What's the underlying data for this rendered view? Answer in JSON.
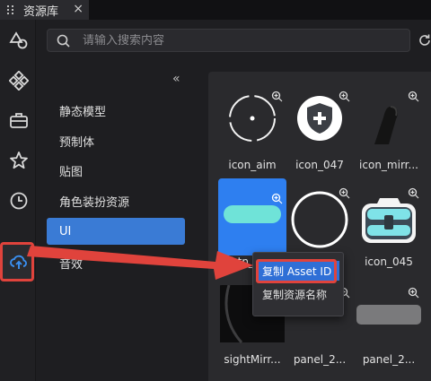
{
  "tab": {
    "title": "资源库",
    "close": "×"
  },
  "search": {
    "placeholder": "请输入搜索内容"
  },
  "categories": {
    "collapse": "«",
    "items": [
      {
        "label": "静态模型"
      },
      {
        "label": "预制体"
      },
      {
        "label": "贴图"
      },
      {
        "label": "角色装扮资源"
      },
      {
        "label": "UI",
        "active": true
      },
      {
        "label": "音效"
      }
    ]
  },
  "assets": [
    {
      "name": "icon_aim"
    },
    {
      "name": "icon_047"
    },
    {
      "name": "icon_mirr..."
    },
    {
      "name": "btn_..."
    },
    {
      "name": ""
    },
    {
      "name": "icon_045"
    },
    {
      "name": "sightMirr..."
    },
    {
      "name": "panel_2..."
    },
    {
      "name": "panel_2..."
    }
  ],
  "context_menu": {
    "items": [
      {
        "label": "复制 Asset ID",
        "highlighted": true
      },
      {
        "label": "复制资源名称"
      }
    ]
  },
  "colors": {
    "accent": "#3a7bd5",
    "annotation": "#e0433c",
    "selected_tile": "#2e7ff0"
  }
}
